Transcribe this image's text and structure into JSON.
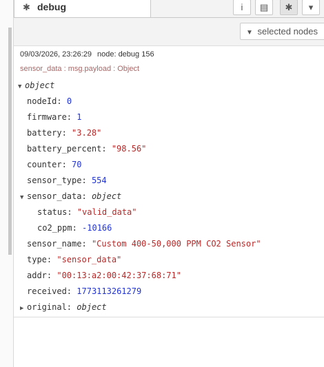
{
  "tab": {
    "icon": "bug-icon",
    "label": "debug"
  },
  "header_buttons": [
    {
      "name": "info-icon",
      "glyph": "i"
    },
    {
      "name": "book-icon",
      "glyph": "▤"
    },
    {
      "name": "bug-icon",
      "glyph": "✱"
    },
    {
      "name": "dropdown-icon",
      "glyph": "▾"
    }
  ],
  "filter": {
    "label": "selected nodes"
  },
  "message": {
    "timestamp": "09/03/2026, 23:26:29",
    "node": "node: debug 156",
    "topic": "sensor_data : msg.payload : Object",
    "root_label": "object",
    "fields": [
      {
        "key": "nodeId:",
        "value": "0",
        "type": "num"
      },
      {
        "key": "firmware:",
        "value": "1",
        "type": "num"
      },
      {
        "key": "battery:",
        "value": "\"3.28\"",
        "type": "str"
      },
      {
        "key": "battery_percent:",
        "value": "\"98.56\"",
        "type": "str"
      },
      {
        "key": "counter:",
        "value": "70",
        "type": "num"
      },
      {
        "key": "sensor_type:",
        "value": "554",
        "type": "num"
      },
      {
        "key": "sensor_data:",
        "value": "object",
        "type": "obj"
      },
      {
        "key": "status:",
        "value": "\"valid_data\"",
        "type": "str"
      },
      {
        "key": "co2_ppm:",
        "value": "-10166",
        "type": "num"
      },
      {
        "key": "sensor_name:",
        "value": "\"Custom 400-50,000 PPM CO2 Sensor\"",
        "type": "str"
      },
      {
        "key": "type:",
        "value": "\"sensor_data\"",
        "type": "str"
      },
      {
        "key": "addr:",
        "value": "\"00:13:a2:00:42:37:68:71\"",
        "type": "str"
      },
      {
        "key": "received:",
        "value": "1773113261279",
        "type": "num"
      },
      {
        "key": "original:",
        "value": "object",
        "type": "obj"
      }
    ]
  }
}
